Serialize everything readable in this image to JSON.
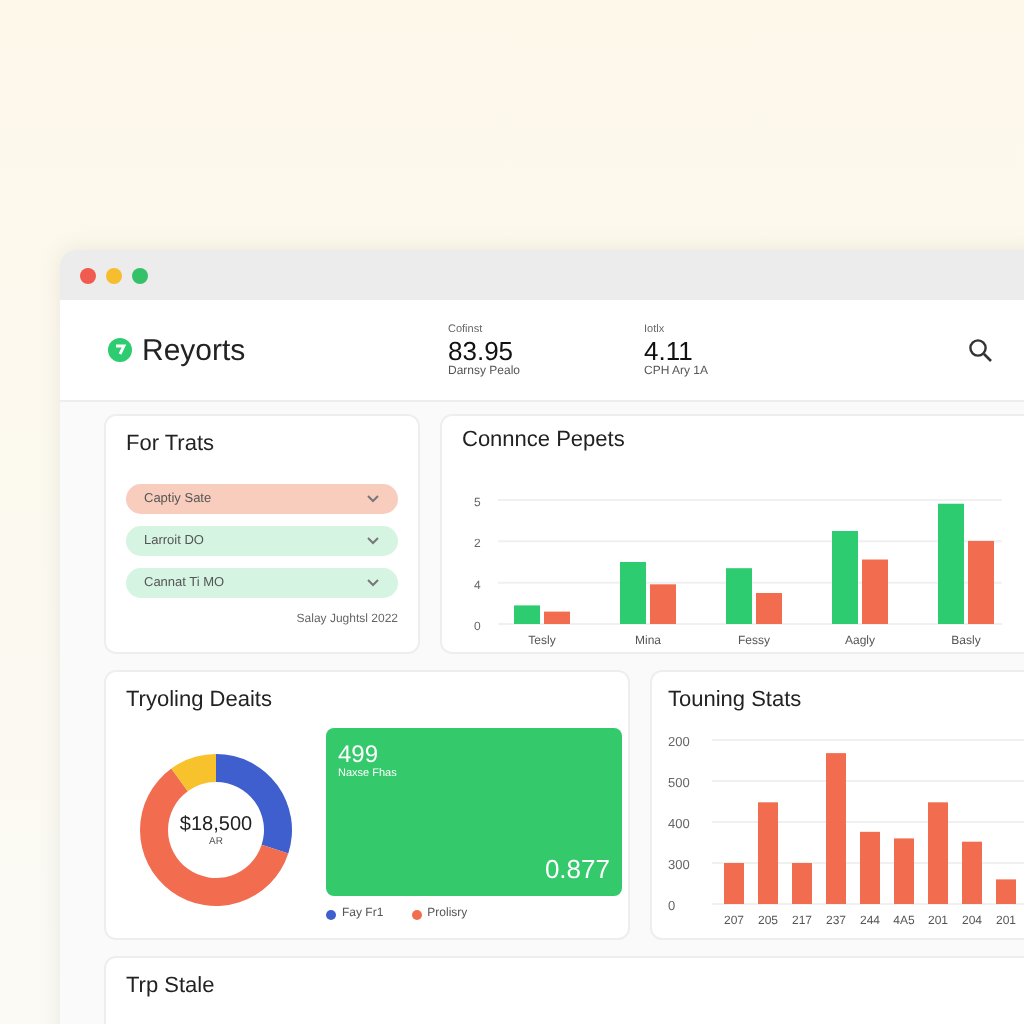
{
  "window": {
    "title": "Reyorts"
  },
  "header_stats": [
    {
      "label": "Cofinst",
      "value": "83.95",
      "sub": "Darnsy Pealo"
    },
    {
      "label": "Iotlx",
      "value": "4.11",
      "sub": "CPH Ary 1A"
    }
  ],
  "filters": {
    "title": "For Trats",
    "dropdowns": [
      {
        "label": "Captiy Sate",
        "color": "#f8cdbd"
      },
      {
        "label": "Larroit DO",
        "color": "#d5f4e2"
      },
      {
        "label": "Cannat Ti MO",
        "color": "#d5f4e2"
      }
    ],
    "footnote": "Salay Jughtsl 2022"
  },
  "compare": {
    "title": "Connnce Pepets",
    "y_axis_labels": [
      "5",
      "2",
      "4",
      "0"
    ],
    "x_axis_labels": [
      "Tesly",
      "Mina",
      "Fessy",
      "Aagly",
      "Basly"
    ]
  },
  "trending": {
    "title": "Tryoling Deaits",
    "donut": {
      "center_value": "$18,500",
      "center_label": "AR",
      "kind": "donut"
    },
    "highlight": {
      "value": "499",
      "label": "Naxse Fhas",
      "reading": "0.877"
    },
    "legend": [
      {
        "label": "Fay Fr1",
        "color": "#3f5fce"
      },
      {
        "label": "Prolisry",
        "color": "#f26d4f"
      }
    ]
  },
  "touring": {
    "title": "Touning Stats",
    "y_axis_labels": [
      "200",
      "500",
      "400",
      "300",
      "0"
    ],
    "x_axis_labels": [
      "207",
      "205",
      "217",
      "237",
      "244",
      "4A5",
      "201",
      "204",
      "201"
    ]
  },
  "bottom_card": {
    "title": "Trp Stale"
  }
}
